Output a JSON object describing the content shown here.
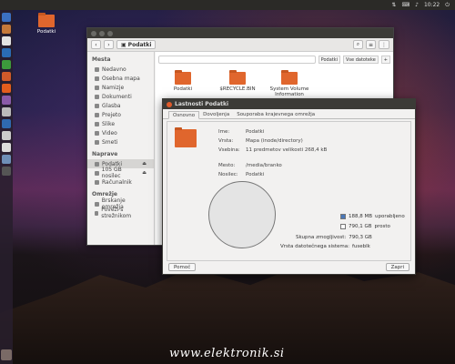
{
  "topbar": {
    "time": "10:22"
  },
  "desktop": {
    "icon_label": "Podatki"
  },
  "fm": {
    "title": "Podatki",
    "path": "Podatki",
    "search_opt1": "Podatki",
    "search_opt2": "Vse datoteke",
    "sidebar": {
      "places_header": "Mesta",
      "places": [
        "Nedavno",
        "Osebna mapa",
        "Namizje",
        "Dokumenti",
        "Glasba",
        "Prejeto",
        "Slike",
        "Video",
        "Smeti"
      ],
      "devices_header": "Naprave",
      "devices": [
        "Podatki",
        "105 GB nosilec",
        "Računalnik"
      ],
      "network_header": "Omrežje",
      "network": [
        "Brskanje omrežja",
        "Poveži s strežnikom"
      ]
    },
    "files": [
      "Podatki",
      "$RECYCLE.BIN",
      "System Volume Information"
    ]
  },
  "dialog": {
    "title": "Lastnosti Podatki",
    "tabs": [
      "Osnovno",
      "Dovoljenja",
      "Souporaba krajevnega omrežja"
    ],
    "name_label": "Ime:",
    "name_value": "Podatki",
    "type_label": "Vrsta:",
    "type_value": "Mapa (inode/directory)",
    "contents_label": "Vsebina:",
    "contents_value": "11 predmetov velikosti 268,4 kB",
    "location_label": "Mesto:",
    "location_value": "/media/branko",
    "volume_label": "Nosilec:",
    "volume_value": "Podatki",
    "used_value": "188,8 MB",
    "used_label": "uporabljeno",
    "free_value": "790,1 GB",
    "free_label": "prosto",
    "capacity_label": "Skupna zmogljivost:",
    "capacity_value": "790,3 GB",
    "fs_label": "Vrsta datotečnega sistema:",
    "fs_value": "fuseblk",
    "help_button": "Pomoč",
    "close_button": "Zapri",
    "used_color": "#4a78b8",
    "free_color": "#ffffff"
  },
  "watermark": "www.elektronik.si"
}
